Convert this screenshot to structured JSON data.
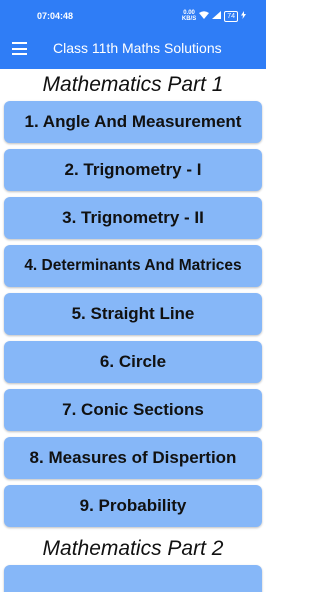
{
  "status_bar": {
    "time": "07:04:48",
    "speed_value": "0.00",
    "speed_unit": "KB/S",
    "battery": "74"
  },
  "toolbar": {
    "title": "Class 11th Maths Solutions",
    "menu_icon": "hamburger-menu-icon"
  },
  "sections": [
    {
      "title": "Mathematics Part 1",
      "topics": [
        "1. Angle And Measurement",
        "2. Trignometry - I",
        "3. Trignometry - II",
        "4. Determinants And Matrices",
        "5. Straight Line",
        "6. Circle",
        "7. Conic Sections",
        "8. Measures of Dispertion",
        "9. Probability"
      ]
    },
    {
      "title": "Mathematics Part 2",
      "topics": []
    }
  ],
  "colors": {
    "app_bar": "#2f7df6",
    "topic_button": "#86b7f8"
  }
}
